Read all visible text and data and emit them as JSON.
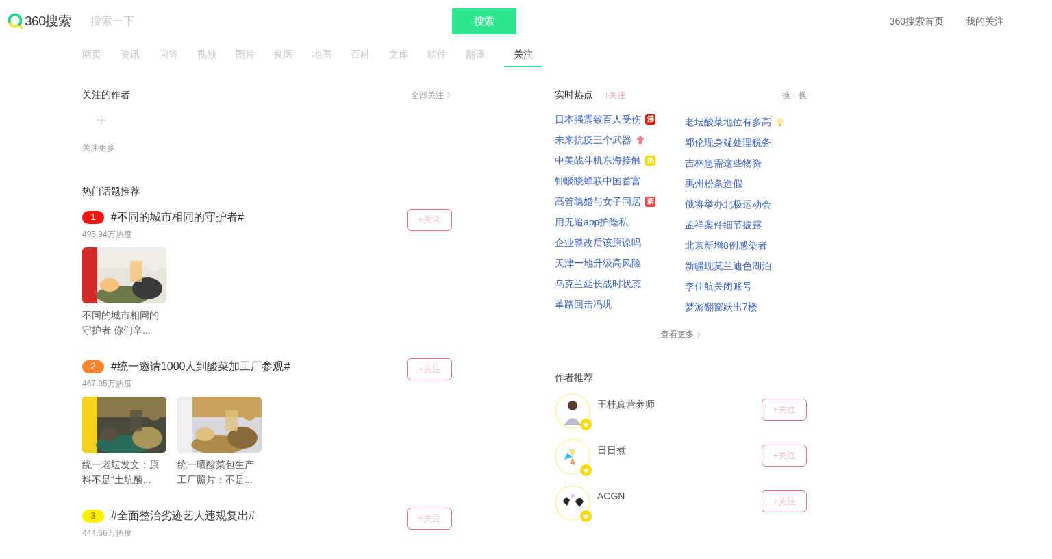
{
  "header": {
    "logo": "360搜索",
    "search": {
      "placeholder": "搜索一下"
    },
    "search_button": "搜索",
    "links": [
      "360搜索首页",
      "我的关注"
    ]
  },
  "tabs": [
    {
      "label": "网页",
      "selected": false
    },
    {
      "label": "资讯",
      "selected": false
    },
    {
      "label": "问答",
      "selected": false
    },
    {
      "label": "视频",
      "selected": false
    },
    {
      "label": "图片",
      "selected": false
    },
    {
      "label": "良医",
      "selected": false
    },
    {
      "label": "地图",
      "selected": false
    },
    {
      "label": "百科",
      "selected": false
    },
    {
      "label": "文库",
      "selected": false
    },
    {
      "label": "软件",
      "selected": false
    },
    {
      "label": "翻译",
      "selected": false
    },
    {
      "label": "关注",
      "selected": true
    }
  ],
  "followed_authors": {
    "title": "关注的作者",
    "all_link": "全部关注",
    "add_label": "关注更多"
  },
  "topics": {
    "title": "热门话题推荐",
    "items": [
      {
        "rank": "1",
        "color": "#f01414",
        "title": "#不同的城市相同的守护者#",
        "heat": "495.94万热度",
        "follow": "+关注",
        "cards": [
          {
            "caption": "不同的城市相同的守护者 你们辛..."
          }
        ]
      },
      {
        "rank": "2",
        "color": "#f5842a",
        "title": "#统一邀请1000人到酸菜加工厂参观#",
        "heat": "467.95万热度",
        "follow": "+关注",
        "cards": [
          {
            "caption": "统一老坛发文：原料不是“土坑酸..."
          },
          {
            "caption": "统一晒酸菜包生产工厂照片：不是..."
          }
        ]
      },
      {
        "rank": "3",
        "color": "#ffee00",
        "title": "#全面整治劣迹艺人违规复出#",
        "heat": "444.66万热度",
        "follow": "+关注"
      }
    ]
  },
  "hot": {
    "title": "实时热点",
    "follow": "+关注",
    "refresh": "换一换",
    "more": "查看更多",
    "items": [
      {
        "text": "日本强震致百人受伤",
        "badge": {
          "kind": "text",
          "label": "沸",
          "color": "#d81e06"
        }
      },
      {
        "text": "老坛酸菜地位有多高",
        "badge": {
          "kind": "bulb"
        }
      },
      {
        "text": "未来抗疫三个武器",
        "badge": {
          "kind": "up"
        }
      },
      {
        "text": "邓伦现身疑处理税务"
      },
      {
        "text": "中美战斗机东海接触",
        "badge": {
          "kind": "text",
          "label": "热",
          "color": "#f5d800"
        }
      },
      {
        "text": "吉林急需这些物资"
      },
      {
        "text": "钟睒睒蝉联中国首富"
      },
      {
        "text": "禹州粉条造假"
      },
      {
        "text": "高管隐婚与女子同居",
        "badge": {
          "kind": "text",
          "label": "新",
          "color": "#f04848"
        }
      },
      {
        "text": "俄将举办北极运动会"
      },
      {
        "text": "用无追app护隐私"
      },
      {
        "text": "孟祥案件细节披露"
      },
      {
        "text": "企业整改后该原谅吗"
      },
      {
        "text": "北京新增8例感染者"
      },
      {
        "text": "天津一地升级高风险"
      },
      {
        "text": "新疆现莫兰迪色湖泊"
      },
      {
        "text": "乌克兰延长战时状态"
      },
      {
        "text": "李佳航关闭账号"
      },
      {
        "text": "革路回击冯巩"
      },
      {
        "text": "梦游翻窗跃出7楼"
      }
    ]
  },
  "recommended_authors": {
    "title": "作者推荐",
    "items": [
      {
        "name": "王桂真营养师",
        "follow": "+关注"
      },
      {
        "name": "日日煮",
        "follow": "+关注"
      },
      {
        "name": "ACGN",
        "follow": "+关注"
      }
    ]
  }
}
